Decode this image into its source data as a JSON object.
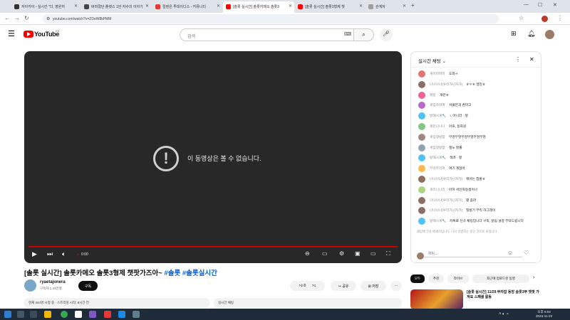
{
  "browser": {
    "tabs": [
      {
        "label": "자아카야 - 실시간 \"더, 영원히",
        "color": "#333333",
        "active": false
      },
      {
        "label": "버려졌던 플랫스 1만 자수의 이야기",
        "color": "#444444",
        "active": false
      },
      {
        "label": "컬렌은 투데이디스 - 커뮤니티",
        "color": "#e53935",
        "active": false
      },
      {
        "label": "[솔롯 실시간] 솔롯카메오 솔롯3",
        "color": "#ff0000",
        "active": true
      },
      {
        "label": "[솔롯 실시간] 솔롯3형제 챗",
        "color": "#ff0000",
        "active": false
      },
      {
        "label": "관계자",
        "color": "#9e9e9e",
        "active": false
      }
    ],
    "url": "youtube.com/watch?v=ZDeW8kPMM"
  },
  "youtube": {
    "logo": "YouTube",
    "logo_region": "KR",
    "search_placeholder": "검색",
    "search_icon": "search-icon"
  },
  "player": {
    "error_text": "이 동영상은 볼 수 없습니다.",
    "time": "0:00",
    "progress_fraction": 1.0
  },
  "video": {
    "title": "[솔롯 실시간] 솔롯카메오 솔롯3형제 챗팟가즈아~",
    "tags": "#솔롯 #솔롯실시간",
    "channel": "ryaetajonera",
    "subscribers": "구독자 1.33만명",
    "subscribe_label": "구독",
    "like_count": "8",
    "share_label": "공유",
    "save_label": "저장",
    "description": "현재 444명 시청 중 · 스트리밍 시작: 8시간 전",
    "live_chat_label": "실시간 채팅"
  },
  "chat": {
    "title": "실시간 채팅",
    "messages": [
      {
        "author": "게이머파이",
        "text": "도와ㅆ",
        "color": "#e57373"
      },
      {
        "author": "나나나나(우리가닌자가)",
        "text": "ㅎㅇㅎ 앵잉ㅎ",
        "color": "#8d6e63"
      },
      {
        "author": "뭐밍",
        "text": "개란ㅎ",
        "color": "#f06292"
      },
      {
        "author": "게임하며파",
        "text": "서울만과 켠마고",
        "color": "#ba68c8"
      },
      {
        "author": "방해시게🔧",
        "text": "ㄴ아니라 · 챙",
        "color": "#4fc3f7"
      },
      {
        "author": "게린니니니",
        "text": "아호, 동자원",
        "color": "#81c784"
      },
      {
        "author": "게임댓방참",
        "text": "부엉부엉부엉부엉부엉부엉",
        "color": "#a1887f"
      },
      {
        "author": "게임댓방참",
        "text": "챙노 할롤",
        "color": "#90a4ae"
      },
      {
        "author": "방해시게🔧",
        "text": "책려 · 챙",
        "color": "#4fc3f7"
      },
      {
        "author": "부리부리파",
        "text": "여기 계잖아",
        "color": "#ffb74d"
      },
      {
        "author": "나나나나(우리가닌자가)",
        "text": "캐아는 칩롱ㅎ",
        "color": "#8d6e63"
      },
      {
        "author": "게리니니리",
        "text": "아하 서인자동생이나",
        "color": "#aed581"
      },
      {
        "author": "나나나나(우리가닌자가)",
        "text": "별 좀라",
        "color": "#8d6e63"
      },
      {
        "author": "나나나나(우리가닌자가)",
        "text": "칠방기 부킥 하그레이",
        "color": "#8d6e63"
      },
      {
        "author": "방해시게🔧",
        "text": "카톡로 신규 채팅입니다 구독, 알림 설정 부탁드립니다",
        "color": "#4fc3f7"
      }
    ],
    "notice": "채팅에 전송 메세지입니다. 다시 연결하는 중인 것으로 보입니다.",
    "input_placeholder": "채팅..."
  },
  "recommendations": {
    "chips": [
      "모두",
      "추천",
      "라이브",
      "최근에 업로드된 동영"
    ],
    "first_title": "[솔롯 실시간] 11/29 무라잡 동방 솔롯3부 챗팟 가져요 스페셜 활동"
  },
  "taskbar": {
    "time": "오후 5:02",
    "date": "2024-11-22"
  }
}
